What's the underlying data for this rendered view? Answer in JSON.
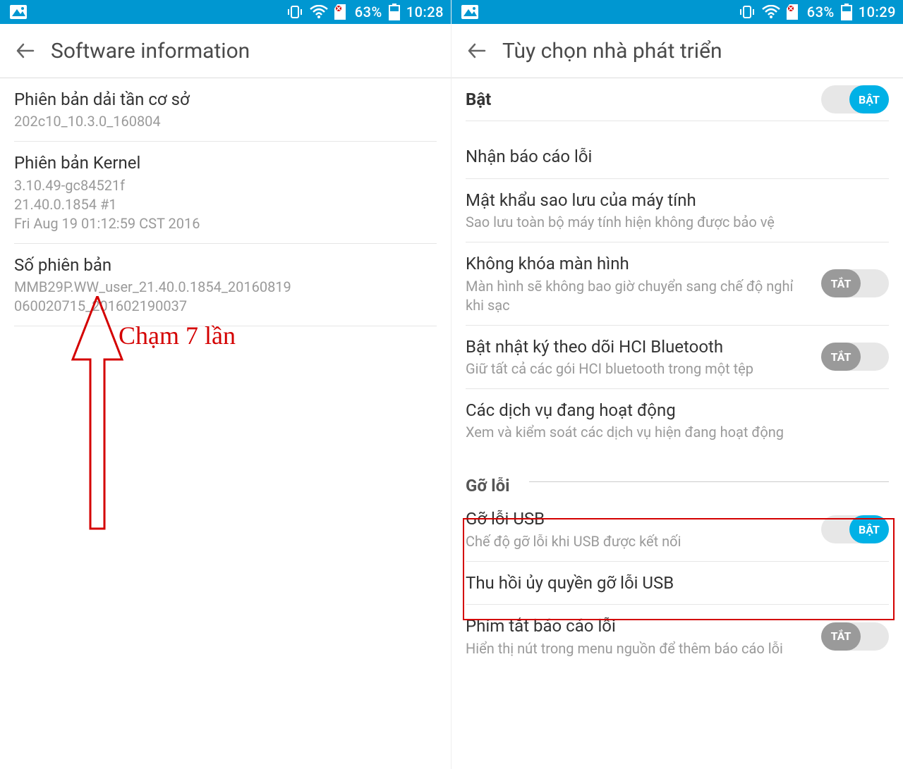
{
  "left": {
    "status": {
      "battery": "63%",
      "time": "10:28"
    },
    "title": "Software information",
    "rows": [
      {
        "primary": "Phiên bản dải tần cơ sở",
        "secondary": "202c10_10.3.0_160804"
      },
      {
        "primary": "Phiên bản Kernel",
        "secondary": "3.10.49-gc84521f\n21.40.0.1854 #1\nFri Aug 19 01:12:59 CST 2016"
      },
      {
        "primary": "Số phiên bản",
        "secondary": "MMB29P.WW_user_21.40.0.1854_20160819\n060020715_201602190037"
      }
    ],
    "annotation": "Chạm 7 lần"
  },
  "right": {
    "status": {
      "battery": "63%",
      "time": "10:29"
    },
    "title": "Tùy chọn nhà phát triển",
    "master": {
      "label": "Bật",
      "toggle_on_label": "BẬT"
    },
    "rows": [
      {
        "primary": "Nhận báo cáo lỗi"
      },
      {
        "primary": "Mật khẩu sao lưu của máy tính",
        "secondary": "Sao lưu toàn bộ máy tính hiện không được bảo vệ"
      },
      {
        "primary": "Không khóa màn hình",
        "secondary": "Màn hình sẽ không bao giờ chuyển sang chế độ nghỉ khi sạc",
        "toggle": "off",
        "toggle_label": "TẮT"
      },
      {
        "primary": "Bật nhật ký theo dõi HCI Bluetooth",
        "secondary": "Giữ tất cả các gói HCI bluetooth trong một tệp",
        "toggle": "off",
        "toggle_label": "TẮT"
      },
      {
        "primary": "Các dịch vụ đang hoạt động",
        "secondary": "Xem và kiểm soát các dịch vụ hiện đang hoạt động"
      }
    ],
    "section": "Gỡ lỗi",
    "debug_rows": [
      {
        "primary": "Gỡ lỗi USB",
        "secondary": "Chế độ gỡ lỗi khi USB được kết nối",
        "toggle": "on",
        "toggle_label": "BẬT"
      },
      {
        "primary": "Thu hồi ủy quyền gỡ lỗi USB"
      },
      {
        "primary": "Phím tắt báo cáo lỗi",
        "secondary": "Hiển thị nút trong menu nguồn để thêm báo cáo lỗi",
        "toggle": "off",
        "toggle_label": "TẮT"
      }
    ]
  },
  "colors": {
    "accent": "#00b1e6",
    "statusbar": "#0097d1",
    "annotation": "#d40000"
  }
}
